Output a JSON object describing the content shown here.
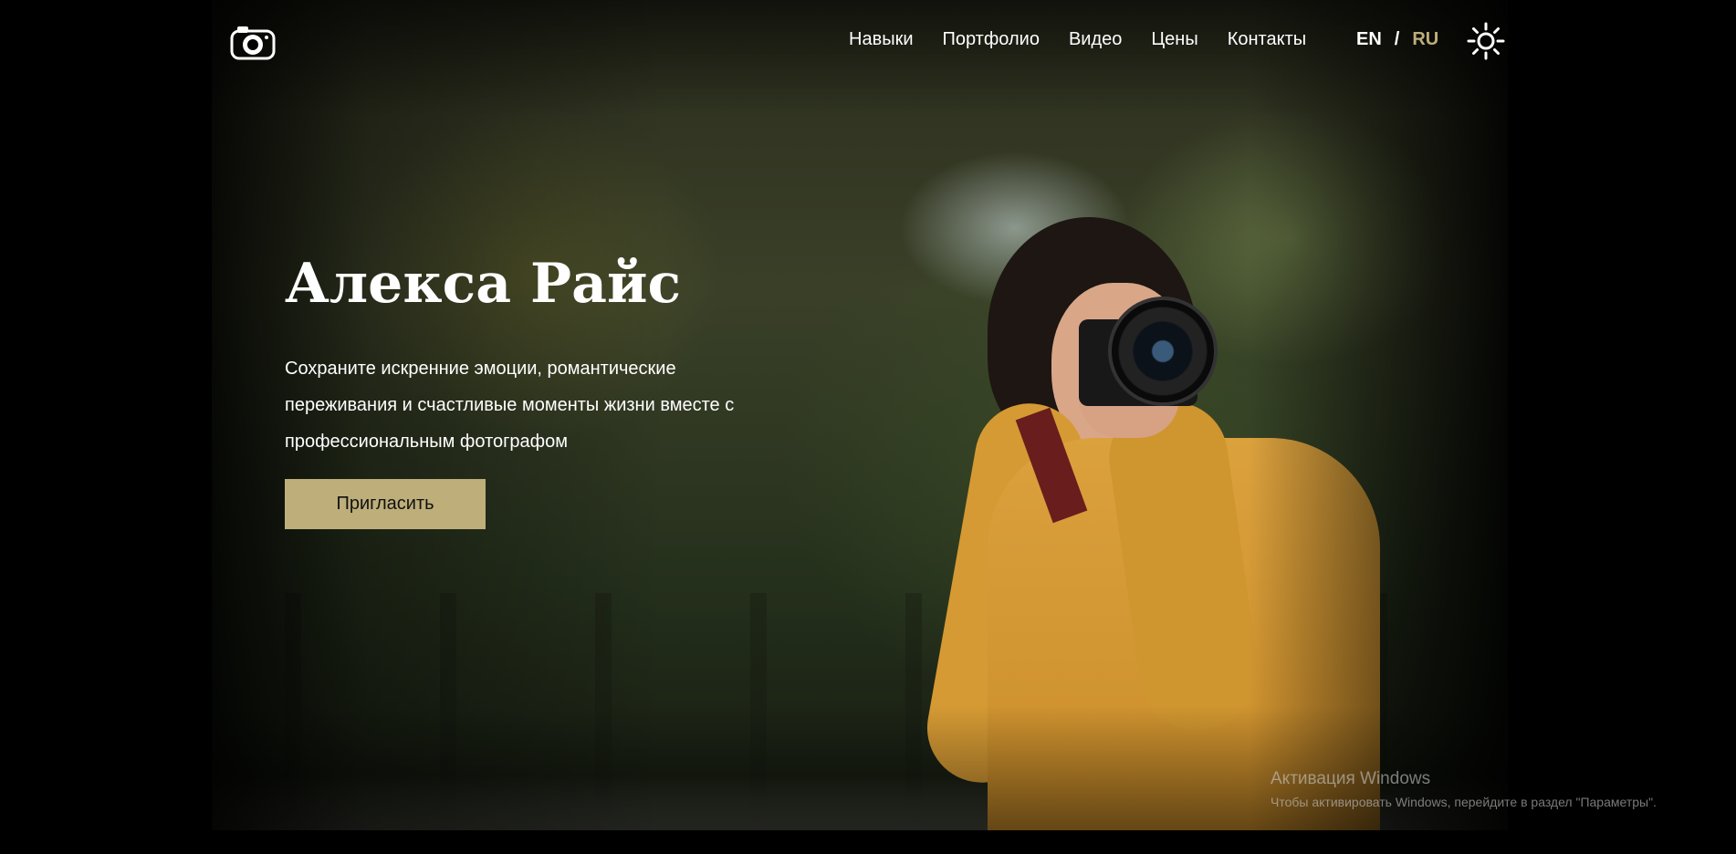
{
  "header": {
    "logo_icon": "camera-icon",
    "nav": [
      {
        "label": "Навыки"
      },
      {
        "label": "Портфолио"
      },
      {
        "label": "Видео"
      },
      {
        "label": "Цены"
      },
      {
        "label": "Контакты"
      }
    ],
    "lang": {
      "en": "EN",
      "sep": "/",
      "ru": "RU"
    },
    "theme_icon": "sun-icon"
  },
  "hero": {
    "title": "Алекса Райс",
    "subtitle": "Сохраните искренние эмоции, романтические переживания и счастливые моменты жизни вместе с профессиональным фотографом",
    "cta_label": "Пригласить"
  },
  "watermark": {
    "title": "Активация Windows",
    "text": "Чтобы активировать Windows, перейдите в раздел \"Параметры\"."
  },
  "colors": {
    "accent": "#bdae7a",
    "text": "#ffffff",
    "background": "#000000"
  }
}
